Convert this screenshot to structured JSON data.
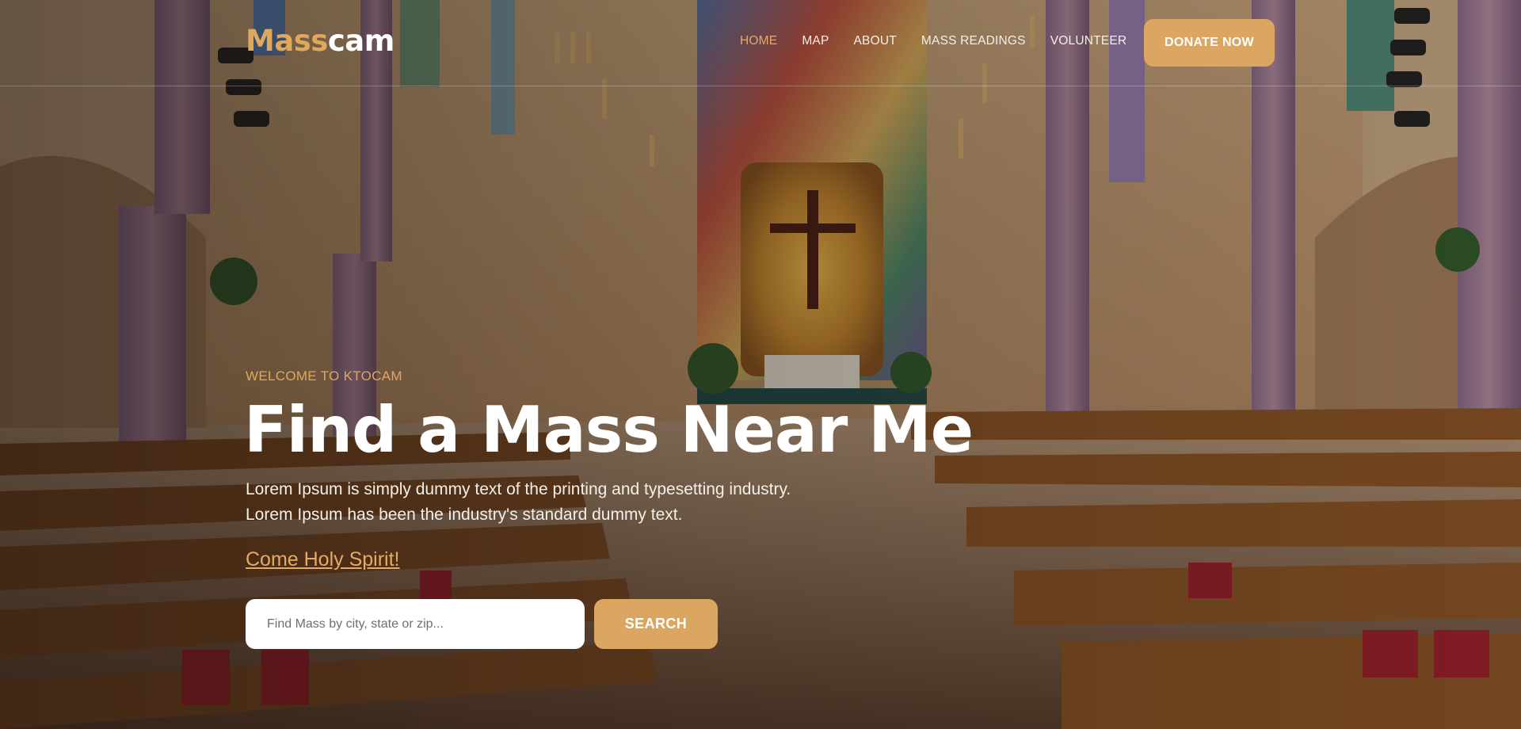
{
  "brand": {
    "logo_part1": "Mass",
    "logo_part2": "cam",
    "accent_color": "#dba661"
  },
  "nav": {
    "items": [
      {
        "label": "HOME",
        "active": true
      },
      {
        "label": "MAP",
        "active": false
      },
      {
        "label": "ABOUT",
        "active": false
      },
      {
        "label": "MASS READINGS",
        "active": false
      },
      {
        "label": "VOLUNTEER",
        "active": false
      }
    ],
    "donate_label": "DONATE NOW"
  },
  "hero": {
    "eyebrow": "WELCOME TO KTOCAM",
    "title": "Find a Mass Near Me",
    "description": "Lorem Ipsum is simply dummy text of the printing and typesetting industry. Lorem Ipsum has been the industry's standard dummy text.",
    "link_text": "Come Holy Spirit!",
    "background": "church interior photo with stained-glass mosaic and crucifix"
  },
  "search": {
    "placeholder": "Find Mass by city, state or zip...",
    "value": "",
    "button_label": "SEARCH"
  }
}
